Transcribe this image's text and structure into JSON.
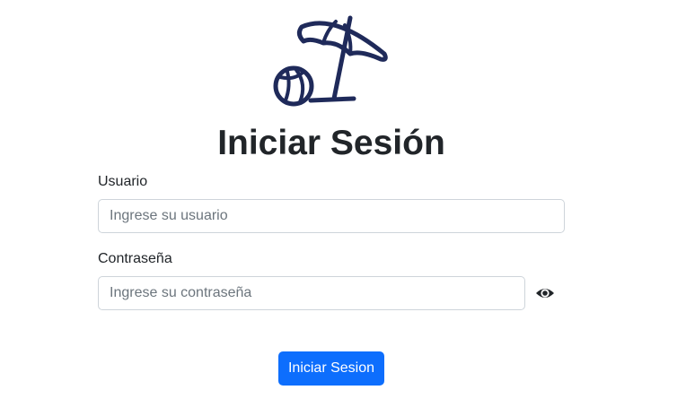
{
  "header": {
    "logo_icon": "beach-umbrella-ball-icon",
    "logo_color": "#1f2a5a",
    "title": "Iniciar Sesión"
  },
  "form": {
    "username": {
      "label": "Usuario",
      "placeholder": "Ingrese su usuario",
      "value": ""
    },
    "password": {
      "label": "Contraseña",
      "placeholder": "Ingrese su contraseña",
      "value": "",
      "toggle_icon": "eye-icon"
    },
    "submit_label": "Iniciar Sesion",
    "submit_color": "#0d6efd"
  }
}
